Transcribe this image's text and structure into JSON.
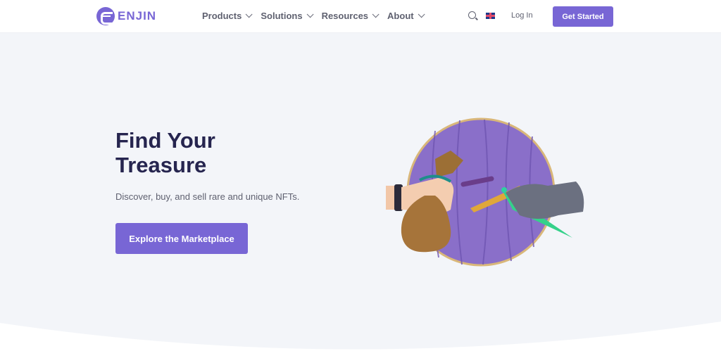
{
  "nav": {
    "logo_text": "ENJIN",
    "menu": [
      {
        "label": "Products"
      },
      {
        "label": "Solutions"
      },
      {
        "label": "Resources"
      },
      {
        "label": "About"
      }
    ],
    "search_icon": "search-icon",
    "language_icon": "uk-flag-icon",
    "login_label": "Log In",
    "get_started_label": "Get Started"
  },
  "hero": {
    "title_line1": "Find Your",
    "title_line2": "Treasure",
    "subtitle": "Discover, buy, and sell rare and unique NFTs.",
    "cta_label": "Explore the Marketplace",
    "illustration": "treasure-trade-illustration"
  },
  "colors": {
    "brand": "#7866d5",
    "heading": "#26254f",
    "hero_bg": "#f3f5f9"
  }
}
